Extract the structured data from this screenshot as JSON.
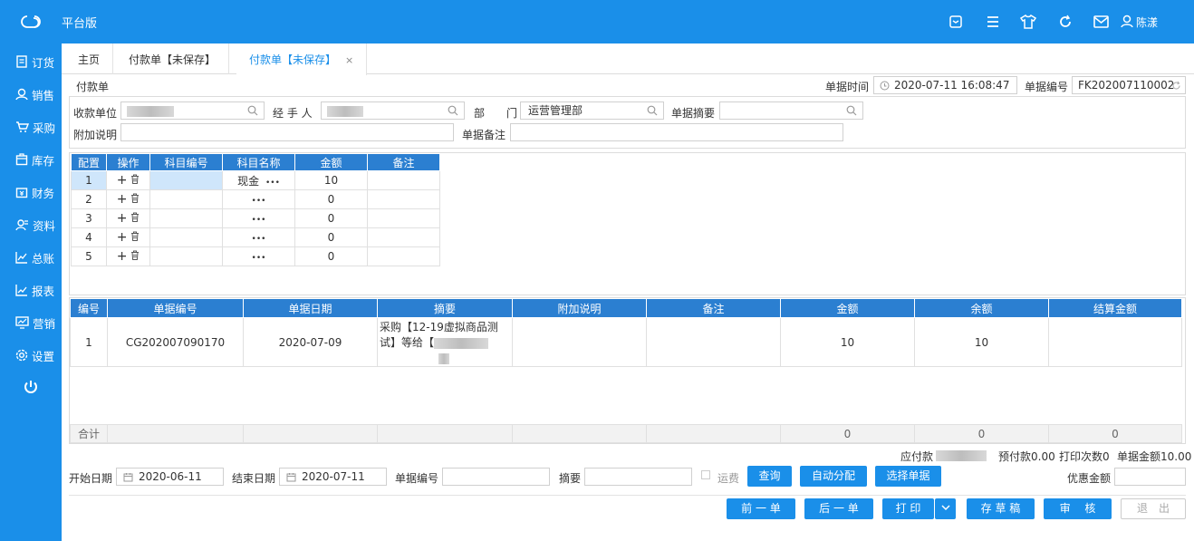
{
  "header": {
    "brand": "平台版",
    "user": "陈漾"
  },
  "sidebar": {
    "items": [
      {
        "label": "订货",
        "icon": "order-icon"
      },
      {
        "label": "销售",
        "icon": "sales-icon"
      },
      {
        "label": "采购",
        "icon": "cart-icon"
      },
      {
        "label": "库存",
        "icon": "inventory-icon"
      },
      {
        "label": "财务",
        "icon": "finance-icon"
      },
      {
        "label": "资料",
        "icon": "profile-icon"
      },
      {
        "label": "总账",
        "icon": "ledger-icon"
      },
      {
        "label": "报表",
        "icon": "report-icon"
      },
      {
        "label": "营销",
        "icon": "marketing-icon"
      },
      {
        "label": "设置",
        "icon": "gear-icon"
      }
    ]
  },
  "tabs": [
    {
      "label": "主页"
    },
    {
      "label": "付款单【未保存】"
    },
    {
      "label": "付款单【未保存】",
      "close": "×"
    }
  ],
  "form": {
    "title": "付款单",
    "time_label": "单据时间",
    "time_value": "2020-07-11 16:08:47",
    "no_label": "单据编号",
    "no_value": "FK202007110002",
    "payee_label": "收款单位",
    "handler_label": "经 手 人",
    "dept_label_1": "部",
    "dept_label_2": "门",
    "dept_value": "运营管理部",
    "summary_label": "单据摘要",
    "extra_label": "附加说明",
    "remark_label": "单据备注"
  },
  "detail": {
    "headers": [
      "配置",
      "操作",
      "科目编号",
      "科目名称",
      "金额",
      "备注"
    ],
    "rows": [
      {
        "no": "1",
        "code": "",
        "name": "现金",
        "amount": "10",
        "remark": ""
      },
      {
        "no": "2",
        "code": "",
        "name": "",
        "amount": "0",
        "remark": ""
      },
      {
        "no": "3",
        "code": "",
        "name": "",
        "amount": "0",
        "remark": ""
      },
      {
        "no": "4",
        "code": "",
        "name": "",
        "amount": "0",
        "remark": ""
      },
      {
        "no": "5",
        "code": "",
        "name": "",
        "amount": "0",
        "remark": ""
      }
    ],
    "more": "•••"
  },
  "bills": {
    "headers": [
      "编号",
      "单据编号",
      "单据日期",
      "摘要",
      "附加说明",
      "备注",
      "金额",
      "余额",
      "结算金额"
    ],
    "rows": [
      {
        "no": "1",
        "bill_no": "CG202007090170",
        "date": "2020-07-09",
        "summary": "采购【12-19虚拟商品测试】等给【",
        "extra": "",
        "remark": "",
        "amount": "10",
        "balance": "10",
        "settle": ""
      }
    ],
    "total_label": "合计",
    "total_amount": "0",
    "total_balance": "0",
    "total_settle": "0"
  },
  "summary": {
    "payable_label": "应付款",
    "prepay": "预付款0.00",
    "print_count": "打印次数0",
    "bill_amount": "单据金额10.00"
  },
  "filter": {
    "start_label": "开始日期",
    "start_value": "2020-06-11",
    "end_label": "结束日期",
    "end_value": "2020-07-11",
    "billno_label": "单据编号",
    "summary_label": "摘要",
    "freight_label": "运费",
    "query": "查询",
    "auto": "自动分配",
    "choose": "选择单据",
    "discount_label": "优惠金额"
  },
  "actions": {
    "prev": "前 一 单",
    "next": "后 一 单",
    "print": "打 印",
    "draft": "存 草 稿",
    "audit": "审　 核",
    "exit": "退　出"
  }
}
